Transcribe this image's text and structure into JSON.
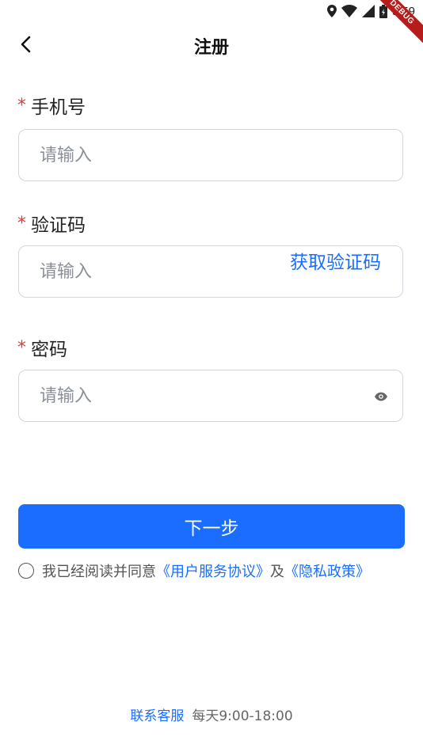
{
  "status_bar": {
    "time": "9:59",
    "debug_label": "DEBUG"
  },
  "header": {
    "title": "注册"
  },
  "form": {
    "phone": {
      "required_mark": "*",
      "label": "手机号",
      "placeholder": "请输入",
      "value": ""
    },
    "code": {
      "required_mark": "*",
      "label": "验证码",
      "placeholder": "请输入",
      "value": "",
      "get_code_label": "获取验证码"
    },
    "password": {
      "required_mark": "*",
      "label": "密码",
      "placeholder": "请输入",
      "value": ""
    }
  },
  "actions": {
    "next_label": "下一步"
  },
  "agreement": {
    "prefix": "我已经阅读并同意",
    "user_agreement": "《用户服务协议》",
    "and": "及",
    "privacy_policy": "《隐私政策》"
  },
  "footer": {
    "contact_label": "联系客服",
    "hours": "每天9:00-18:00"
  },
  "colors": {
    "accent": "#1a6dff",
    "required": "#e53935",
    "border": "#d3d6dc"
  }
}
